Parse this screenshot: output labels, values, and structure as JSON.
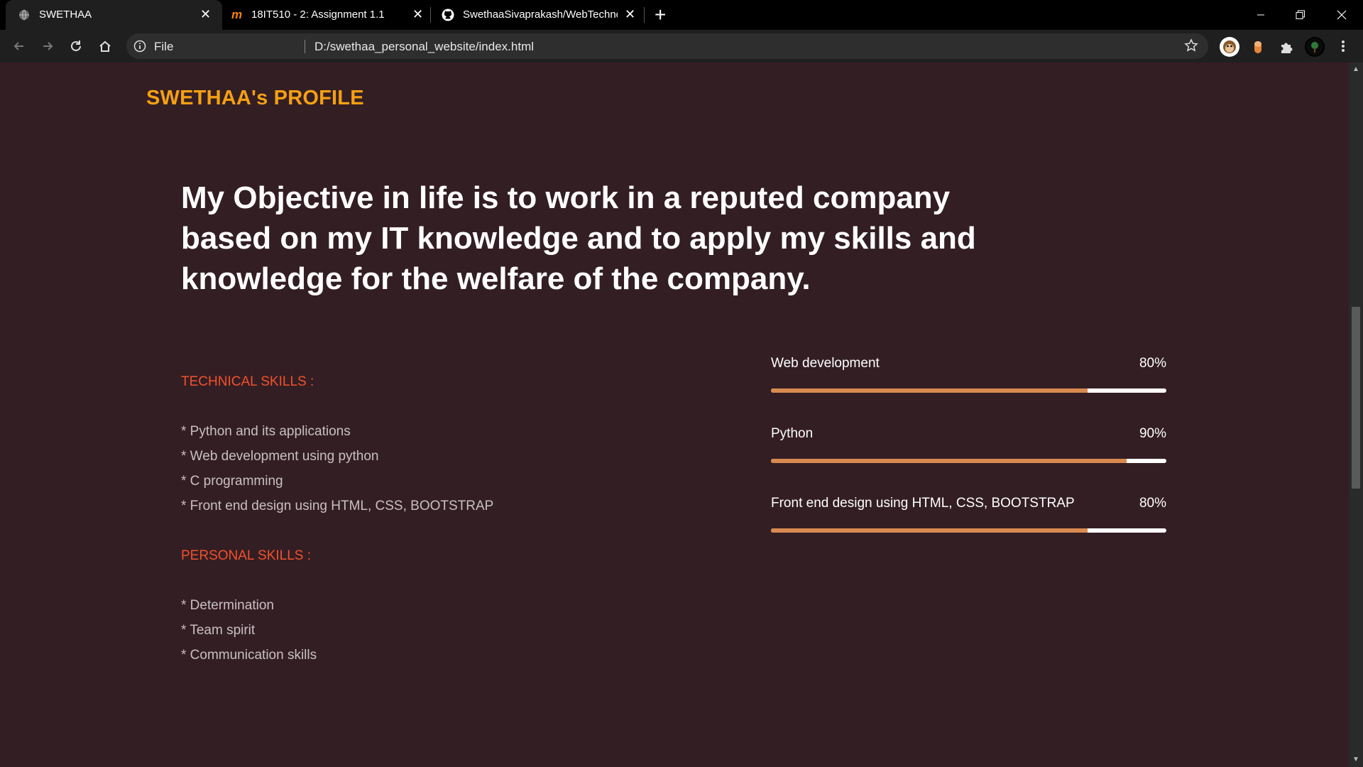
{
  "browser": {
    "tabs": [
      {
        "title": "SWETHAA",
        "active": true
      },
      {
        "title": "18IT510 - 2: Assignment 1.1",
        "active": false
      },
      {
        "title": "SwethaaSivaprakash/WebTechno",
        "active": false
      }
    ],
    "address": {
      "scheme_label": "File",
      "url": "D:/swethaa_personal_website/index.html"
    }
  },
  "page": {
    "brand": "SWETHAA's PROFILE",
    "objective": "My Objective in life is to work in a reputed company based on my IT knowledge and to apply my skills and knowledge for the welfare of the company.",
    "technical": {
      "title": "TECHNICAL SKILLS :",
      "items": [
        "* Python and its applications",
        "* Web development using python",
        "* C programming",
        "* Front end design using HTML, CSS, BOOTSTRAP"
      ]
    },
    "personal": {
      "title": "PERSONAL SKILLS :",
      "items": [
        "* Determination",
        "* Team spirit",
        "* Communication skills"
      ]
    },
    "progress": [
      {
        "label": "Web development",
        "percent_text": "80%",
        "fraction": 0.8
      },
      {
        "label": "Python",
        "percent_text": "90%",
        "fraction": 0.9
      },
      {
        "label": "Front end design using HTML, CSS, BOOTSTRAP",
        "percent_text": "80%",
        "fraction": 0.8
      }
    ]
  },
  "colors": {
    "background": "#331e24",
    "brand": "#f5a013",
    "section_title": "#f3512b",
    "bar_fill": "#d98a50",
    "bar_track": "#ffffff"
  },
  "icons": [
    "globe-icon",
    "moodle-icon",
    "github-icon",
    "close-icon",
    "plus-icon",
    "minimize-icon",
    "restore-icon",
    "back-icon",
    "forward-icon",
    "reload-icon",
    "home-icon",
    "info-icon",
    "star-icon",
    "puzzle-icon",
    "menu-dots-icon"
  ]
}
